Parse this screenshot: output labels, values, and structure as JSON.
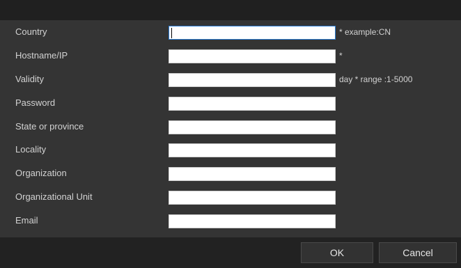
{
  "form": {
    "fields": [
      {
        "label": "Country",
        "value": "",
        "hint": "* example:CN",
        "focused": true
      },
      {
        "label": "Hostname/IP",
        "value": "",
        "hint": "*"
      },
      {
        "label": "Validity",
        "value": "",
        "hint": "day *  range :1-5000"
      },
      {
        "label": "Password",
        "value": "",
        "hint": ""
      },
      {
        "label": "State or province",
        "value": "",
        "hint": ""
      },
      {
        "label": "Locality",
        "value": "",
        "hint": ""
      },
      {
        "label": "Organization",
        "value": "",
        "hint": ""
      },
      {
        "label": "Organizational Unit",
        "value": "",
        "hint": ""
      },
      {
        "label": "Email",
        "value": "",
        "hint": ""
      }
    ]
  },
  "footer": {
    "ok_label": "OK",
    "cancel_label": "Cancel"
  },
  "colors": {
    "background": "#343434",
    "titlebar": "#202020",
    "footer": "#222222",
    "label_text": "#d2d2d2",
    "input_bg": "#ffffff",
    "focus_border": "#2d7fd6"
  }
}
